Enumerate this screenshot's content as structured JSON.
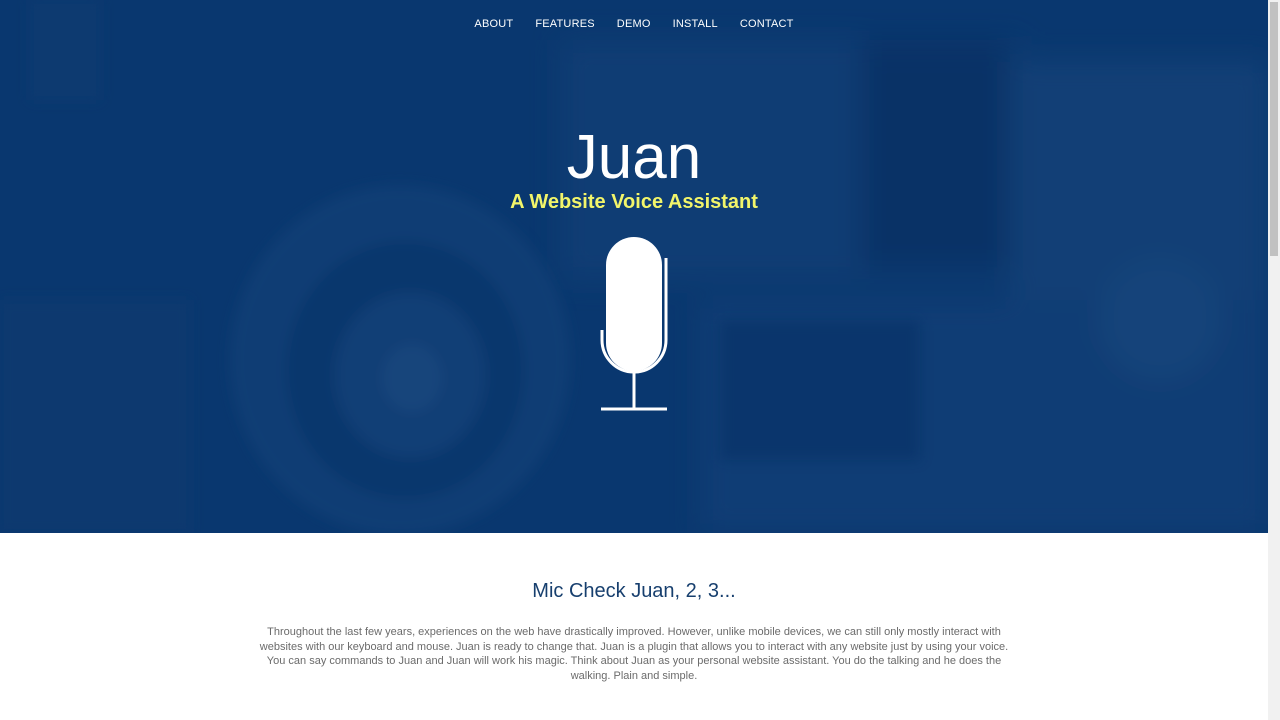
{
  "nav": {
    "items": [
      {
        "label": "ABOUT"
      },
      {
        "label": "FEATURES"
      },
      {
        "label": "DEMO"
      },
      {
        "label": "INSTALL"
      },
      {
        "label": "CONTACT"
      }
    ]
  },
  "hero": {
    "title": "Juan",
    "subtitle": "A Website Voice Assistant",
    "icon": "microphone-icon"
  },
  "about": {
    "heading": "Mic Check Juan, 2, 3...",
    "body": "Throughout the last few years, experiences on the web have drastically improved. However, unlike mobile devices, we can still only mostly interact with websites with our keyboard and mouse. Juan is ready to change that. Juan is a plugin that allows you to interact with any website just by using your voice. You can say commands to Juan and Juan will work his magic. Think about Juan as your personal website assistant. You do the talking and he does the walking. Plain and simple."
  },
  "colors": {
    "hero_blue": "#0c3a72",
    "subtitle_yellow": "#f2f56a",
    "heading_blue": "#173f6e",
    "body_gray": "#6b6b6b"
  }
}
